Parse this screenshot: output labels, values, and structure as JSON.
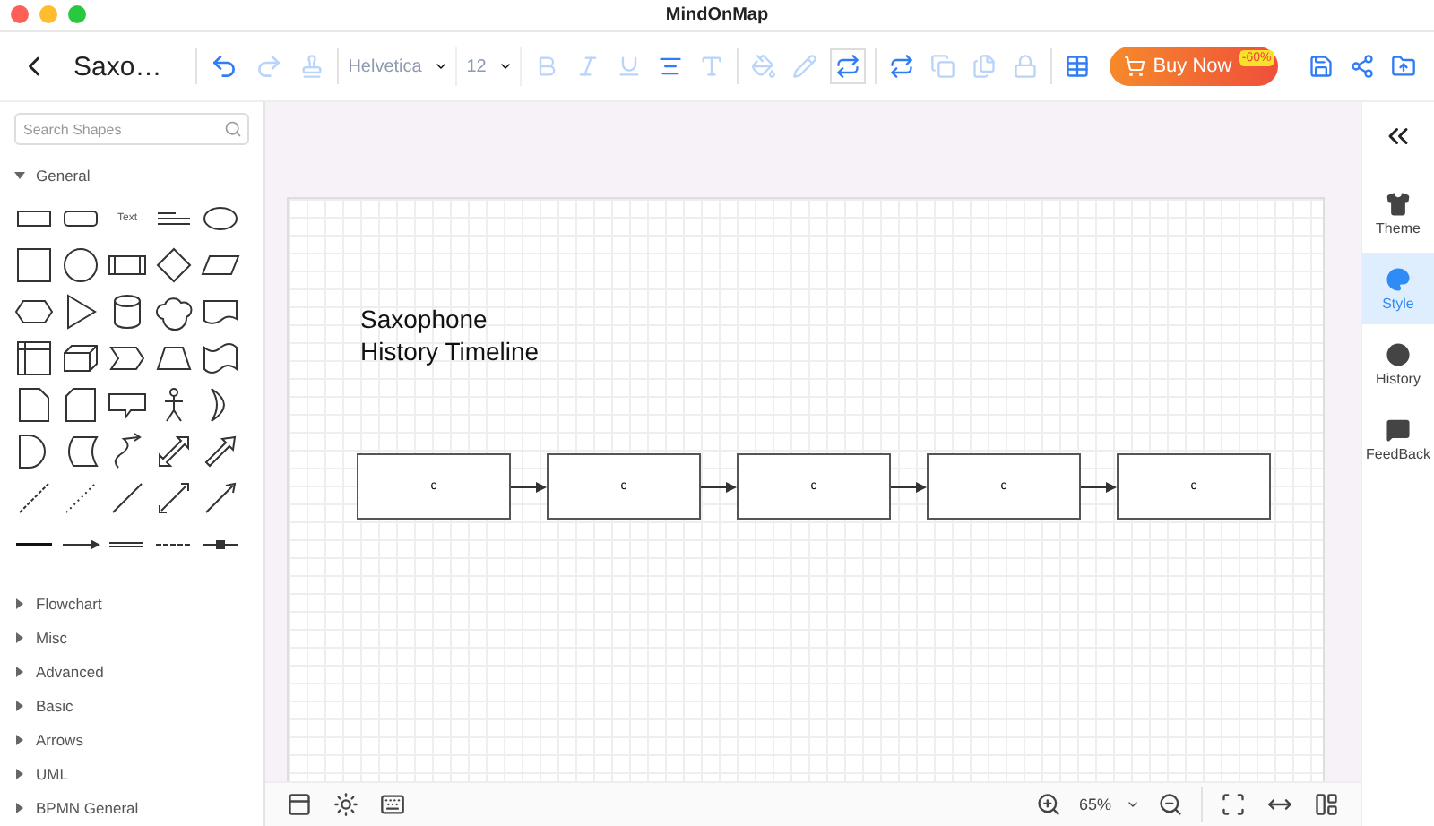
{
  "window": {
    "title": "MindOnMap"
  },
  "toolbar": {
    "doc_title": "Saxo…",
    "font": {
      "value": "Helvetica",
      "disabled": true
    },
    "size": {
      "value": "12",
      "disabled": true
    },
    "buy_button": {
      "label": "Buy Now",
      "badge": "-60%"
    }
  },
  "sidebar": {
    "search": {
      "placeholder": "Search Shapes"
    },
    "palette_text": "Text",
    "categories": [
      {
        "label": "General",
        "expanded": true
      },
      {
        "label": "Flowchart",
        "expanded": false
      },
      {
        "label": "Misc",
        "expanded": false
      },
      {
        "label": "Advanced",
        "expanded": false
      },
      {
        "label": "Basic",
        "expanded": false
      },
      {
        "label": "Arrows",
        "expanded": false
      },
      {
        "label": "UML",
        "expanded": false
      },
      {
        "label": "BPMN General",
        "expanded": false
      }
    ]
  },
  "canvas": {
    "title": "Saxophone\nHistory Timeline",
    "nodes": [
      {
        "label": "c"
      },
      {
        "label": "c"
      },
      {
        "label": "c"
      },
      {
        "label": "c"
      },
      {
        "label": "c"
      }
    ]
  },
  "right_panel": {
    "items": [
      {
        "label": "Theme",
        "selected": false
      },
      {
        "label": "Style",
        "selected": true
      },
      {
        "label": "History",
        "selected": false
      },
      {
        "label": "FeedBack",
        "selected": false
      }
    ]
  },
  "bottom_bar": {
    "zoom": "65%"
  }
}
